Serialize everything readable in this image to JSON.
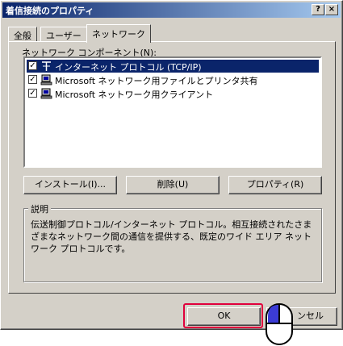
{
  "window": {
    "title": "着信接続のプロパティ",
    "help_button": "?",
    "close_button": "×"
  },
  "tabs": [
    {
      "label": "全般",
      "active": false
    },
    {
      "label": "ユーザー",
      "active": false
    },
    {
      "label": "ネットワーク",
      "active": true
    }
  ],
  "components": {
    "label": "ネットワーク コンポーネント(N):",
    "items": [
      {
        "label": "インターネット プロトコル (TCP/IP)",
        "checked": true,
        "selected": true,
        "icon": "protocol-icon"
      },
      {
        "label": "Microsoft ネットワーク用ファイルとプリンタ共有",
        "checked": true,
        "selected": false,
        "icon": "network-service-icon"
      },
      {
        "label": "Microsoft ネットワーク用クライアント",
        "checked": true,
        "selected": false,
        "icon": "network-client-icon"
      }
    ]
  },
  "buttons": {
    "install": "インストール(I)...",
    "uninstall": "削除(U)",
    "properties": "プロパティ(R)"
  },
  "description": {
    "title": "説明",
    "text": "伝送制御プロトコル/インターネット プロトコル。相互接続されたさまざまなネットワーク間の通信を提供する、既定のワイド エリア ネットワーク プロトコルです。"
  },
  "footer": {
    "ok": "OK",
    "cancel": "キャンセル",
    "cancel_visible": "ンセル"
  },
  "colors": {
    "titlebar_start": "#0a246a",
    "titlebar_end": "#a6caf0",
    "selection": "#0a246a",
    "face": "#d4d0c8",
    "highlight_box": "#e0003c",
    "mouse_button": "#3b3bd6"
  }
}
